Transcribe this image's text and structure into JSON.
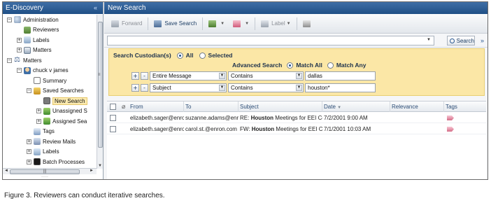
{
  "left_panel": {
    "title": "E-Discovery",
    "tree": [
      {
        "label": "Administration",
        "level": 0,
        "expander": "−",
        "icon": "admin-icon"
      },
      {
        "label": "Reviewers",
        "level": 1,
        "expander": "",
        "icon": "reviewers-icon"
      },
      {
        "label": "Labels",
        "level": 1,
        "expander": "+",
        "icon": "labels-icon"
      },
      {
        "label": "Matters",
        "level": 1,
        "expander": "+",
        "icon": "matters-icon"
      },
      {
        "label": "Matters",
        "level": 0,
        "expander": "−",
        "icon": "scale-icon"
      },
      {
        "label": "chuck v james",
        "level": 1,
        "expander": "−",
        "icon": "person-icon"
      },
      {
        "label": "Summary",
        "level": 2,
        "expander": "",
        "icon": "summary-icon"
      },
      {
        "label": "Saved Searches",
        "level": 2,
        "expander": "−",
        "icon": "saved-searches-icon"
      },
      {
        "label": "New Search",
        "level": 3,
        "expander": "",
        "icon": "search-grid-icon",
        "selected": true
      },
      {
        "label": "Unassigned S",
        "level": 3,
        "expander": "+",
        "icon": "unassigned-icon"
      },
      {
        "label": "Assigned Sea",
        "level": 3,
        "expander": "+",
        "icon": "assigned-icon"
      },
      {
        "label": "Tags",
        "level": 2,
        "expander": "",
        "icon": "tags-icon"
      },
      {
        "label": "Review Mails",
        "level": 2,
        "expander": "+",
        "icon": "review-mails-icon"
      },
      {
        "label": "Labels",
        "level": 2,
        "expander": "+",
        "icon": "labels-icon"
      },
      {
        "label": "Batch Processes",
        "level": 2,
        "expander": "+",
        "icon": "batch-icon"
      }
    ]
  },
  "right_panel": {
    "title": "New Search",
    "toolbar": {
      "forward": "Forward",
      "save_search": "Save Search",
      "label": "Label"
    },
    "search": {
      "value": "",
      "button": "Search"
    },
    "criteria": {
      "custodian_label": "Search Custodian(s)",
      "all": "All",
      "selected": "Selected",
      "advanced_label": "Advanced Search",
      "match_all": "Match All",
      "match_any": "Match Any",
      "rows": [
        {
          "field": "Entire Message",
          "operator": "Contains",
          "value": "dallas"
        },
        {
          "field": "Subject",
          "operator": "Contains",
          "value": "houston*"
        }
      ]
    },
    "grid": {
      "columns": [
        "From",
        "To",
        "Subject",
        "Date",
        "Relevance",
        "Tags"
      ],
      "rows": [
        {
          "from": "elizabeth.sager@enro",
          "to": "suzanne.adams@enro",
          "subject_prefix": "RE: ",
          "subject_bold": "Houston",
          "subject_rest": " Meetings for EEI Con",
          "date": "7/2/2001 9:00 AM"
        },
        {
          "from": "elizabeth.sager@enro",
          "to": "carol.st.@enron.com",
          "subject_prefix": "FW: ",
          "subject_bold": "Houston",
          "subject_rest": " Meetings for EEI Con",
          "date": "7/1/2001 10:03 AM"
        }
      ]
    }
  },
  "caption": "Figure 3. Reviewers can conduct iterative searches."
}
